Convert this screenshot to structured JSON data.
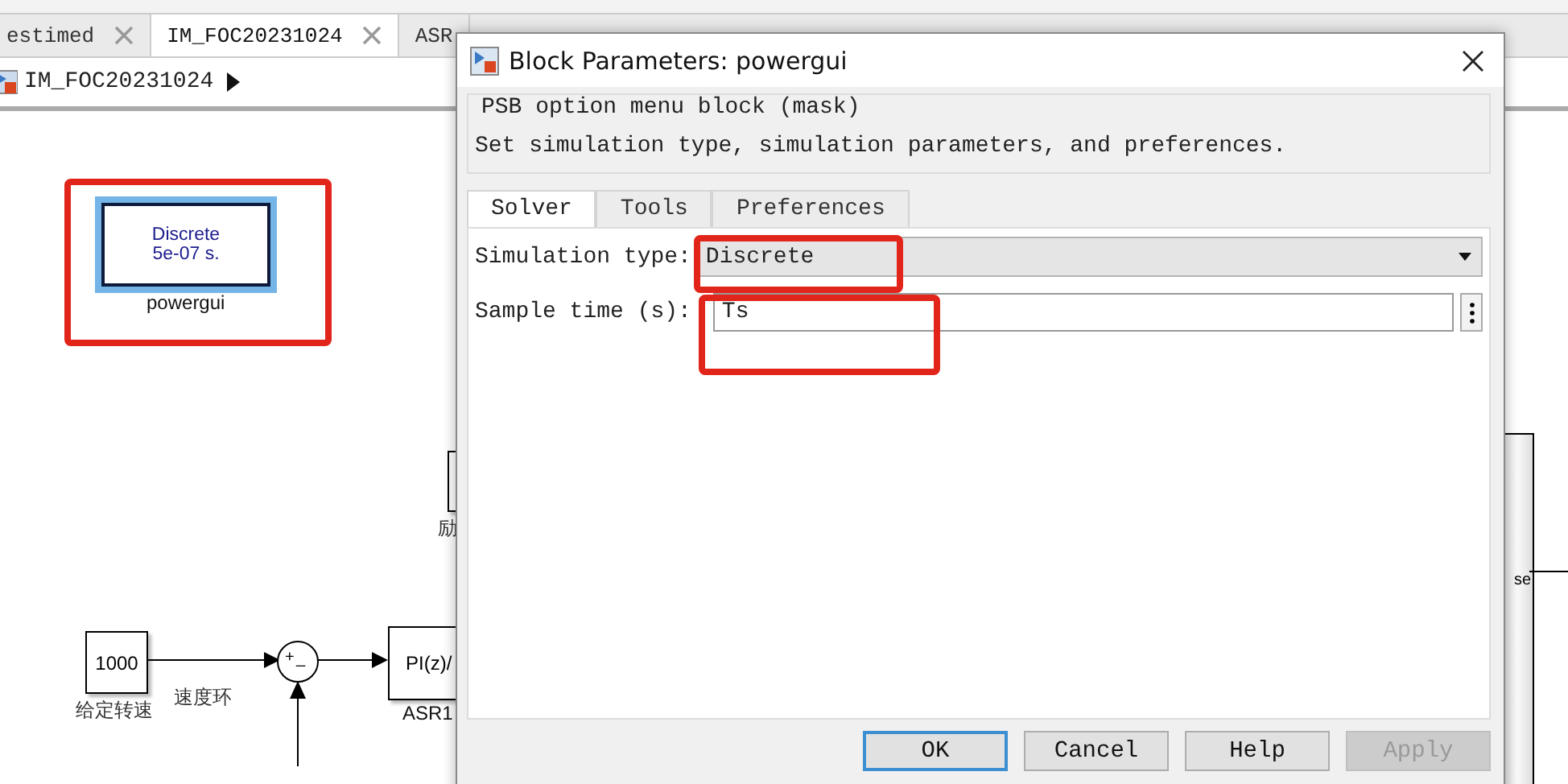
{
  "tabs": [
    {
      "label": "estimed",
      "selected": false,
      "closable": true
    },
    {
      "label": "IM_FOC20231024",
      "selected": true,
      "closable": true
    },
    {
      "label": "ASR",
      "selected": false,
      "closable": false
    }
  ],
  "breadcrumb": {
    "label": "IM_FOC20231024"
  },
  "diagram": {
    "powergui": {
      "line_1": "Discrete",
      "line_2": "5e-07 s.",
      "label": "powergui"
    },
    "constant": {
      "value": "1000",
      "label": "给定转速"
    },
    "signal_label": "速度环",
    "sum": {
      "sign_1": "+",
      "sign_2": "_"
    },
    "controller": {
      "text": "PI(z)/",
      "label": "ASR1"
    },
    "partial_label": "励",
    "right_block_text": "se"
  },
  "dialog": {
    "title": "Block Parameters: powergui",
    "mask_title": "PSB option menu block (mask)",
    "description": "Set simulation type, simulation parameters, and preferences.",
    "tabs": [
      {
        "label": "Solver",
        "selected": true
      },
      {
        "label": "Tools",
        "selected": false
      },
      {
        "label": "Preferences",
        "selected": false
      }
    ],
    "params": [
      {
        "kind": "dropdown",
        "label": "Simulation type:",
        "value": "Discrete"
      },
      {
        "kind": "text",
        "label": "Sample time (s):",
        "value": "Ts"
      }
    ],
    "buttons": [
      {
        "label": "OK",
        "focused": true,
        "disabled": false
      },
      {
        "label": "Cancel",
        "focused": false,
        "disabled": false
      },
      {
        "label": "Help",
        "focused": false,
        "disabled": false
      },
      {
        "label": "Apply",
        "focused": false,
        "disabled": true
      }
    ]
  }
}
